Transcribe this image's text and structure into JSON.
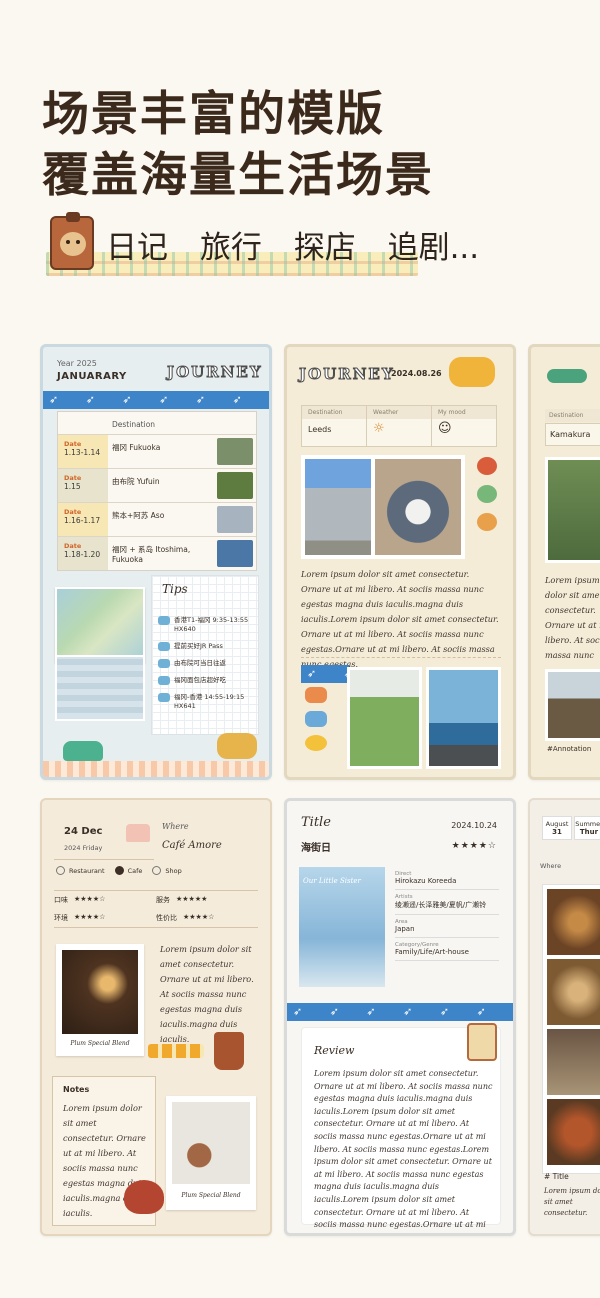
{
  "headline": {
    "line1": "场景丰富的模版",
    "line2": "覆盖海量生活场景"
  },
  "tags": [
    "日记",
    "旅行",
    "探店",
    "追剧..."
  ],
  "card1": {
    "year": "Year 2025",
    "month": "JANUARARY",
    "title": "JOURNEY",
    "birds": "➶ ➶ ➶ ➶ ➶ ➶ ➶ ➶ ➶ ➶",
    "destination_header": "Destination",
    "date_label": "Date",
    "rows": [
      {
        "date": "1.13-1.14",
        "dest": "福冈  Fukuoka",
        "color": "#7a8f6a"
      },
      {
        "date": "1.15",
        "dest": "由布院 Yufuin",
        "color": "#5e7c3f"
      },
      {
        "date": "1.16-1.17",
        "dest": "熊本+阿苏 Aso",
        "color": "#a7b4bf"
      },
      {
        "date": "1.18-1.20",
        "dest": "福冈 + 系岛 Itoshima, Fukuoka",
        "color": "#4a77a6"
      }
    ],
    "tips_title": "Tips",
    "tips": [
      "香港T1-福冈 9:35-13:55 HX640",
      "提前买好JR Pass",
      "由布院可当日往返",
      "福冈面包店超好吃",
      "福冈-香港  14:55-19:15 HX641"
    ]
  },
  "card2": {
    "title": "JOURNEY",
    "date": "2024.08.26",
    "labels": [
      "Destination",
      "Weather",
      "My mood"
    ],
    "destination": "Leeds",
    "weather": "☼",
    "mood": "☺",
    "lorem": "Lorem ipsum dolor sit amet consectetur. Ornare ut at mi libero. At sociis massa nunc egestas magna duis iaculis.magna duis iaculis.Lorem ipsum dolor sit amet consectetur. Ornare ut at mi libero. At sociis massa nunc egestas.Ornare ut at mi libero. At sociis massa nunc egestas."
  },
  "card3": {
    "label": "Destination",
    "destination": "Kamakura",
    "lorem": "Lorem ipsum dolor sit amet consectetur. Ornare ut at mi libero. At sociis massa nunc",
    "annotation": "#Annotation"
  },
  "card4": {
    "day": "24 Dec",
    "subdate": "2024 Friday",
    "where_label": "Where",
    "place": "Café Amore",
    "options": [
      "Restaurant",
      "Cafe",
      "Shop"
    ],
    "ratings": [
      {
        "label": "口味",
        "stars": "★★★★☆",
        "label2": "服务",
        "stars2": "★★★★★"
      },
      {
        "label": "环境",
        "stars": "★★★★☆",
        "label2": "性价比",
        "stars2": "★★★★☆"
      }
    ],
    "photo_caption": "Plum Special Blend",
    "lorem": "Lorem ipsum dolor sit amet consectetur. Ornare ut at mi libero. At sociis massa nunc egestas magna duis iaculis.magna duis iaculis.",
    "notes_title": "Notes",
    "notes": "Lorem ipsum dolor sit amet consectetur. Ornare ut at mi libero. At sociis massa nunc egestas magna duis iaculis.magna duis iaculis.",
    "photo2_caption": "Plum Special Blend"
  },
  "card5": {
    "title": "Title",
    "date": "2024.10.24",
    "movie": "海街日",
    "stars": "★★★★☆",
    "poster_text": "Our Little Sister",
    "meta": [
      {
        "k": "Direct",
        "v": "Hirokazu Koreeda"
      },
      {
        "k": "Artists",
        "v": "绫濑遥/长泽雅美/夏帆/广濑铃"
      },
      {
        "k": "Area",
        "v": "Japan"
      },
      {
        "k": "Category/Genre",
        "v": "Family/Life/Art-house"
      }
    ],
    "review_title": "Review",
    "review": "Lorem ipsum dolor sit amet consectetur. Ornare ut at mi libero. At sociis massa nunc egestas magna duis iaculis.magna duis iaculis.Lorem ipsum dolor sit amet consectetur. Ornare ut at mi libero. At sociis massa nunc egestas.Ornare ut at mi libero. At sociis massa nunc egestas.Lorem ipsum dolor sit amet consectetur. Ornare ut at mi libero. At sociis massa nunc egestas magna duis iaculis.magna duis iaculis.Lorem ipsum dolor sit amet consectetur. Ornare ut at mi libero. At sociis massa nunc egestas.Ornare ut at mi libero. At sociis massa nunc egestas."
  },
  "card6": {
    "month1": "August",
    "day1": "31",
    "month2": "Summer",
    "day2": "Thur",
    "where": "Where",
    "title": "# Title",
    "lorem": "Lorem ipsum dolor sit amet consectetur."
  }
}
